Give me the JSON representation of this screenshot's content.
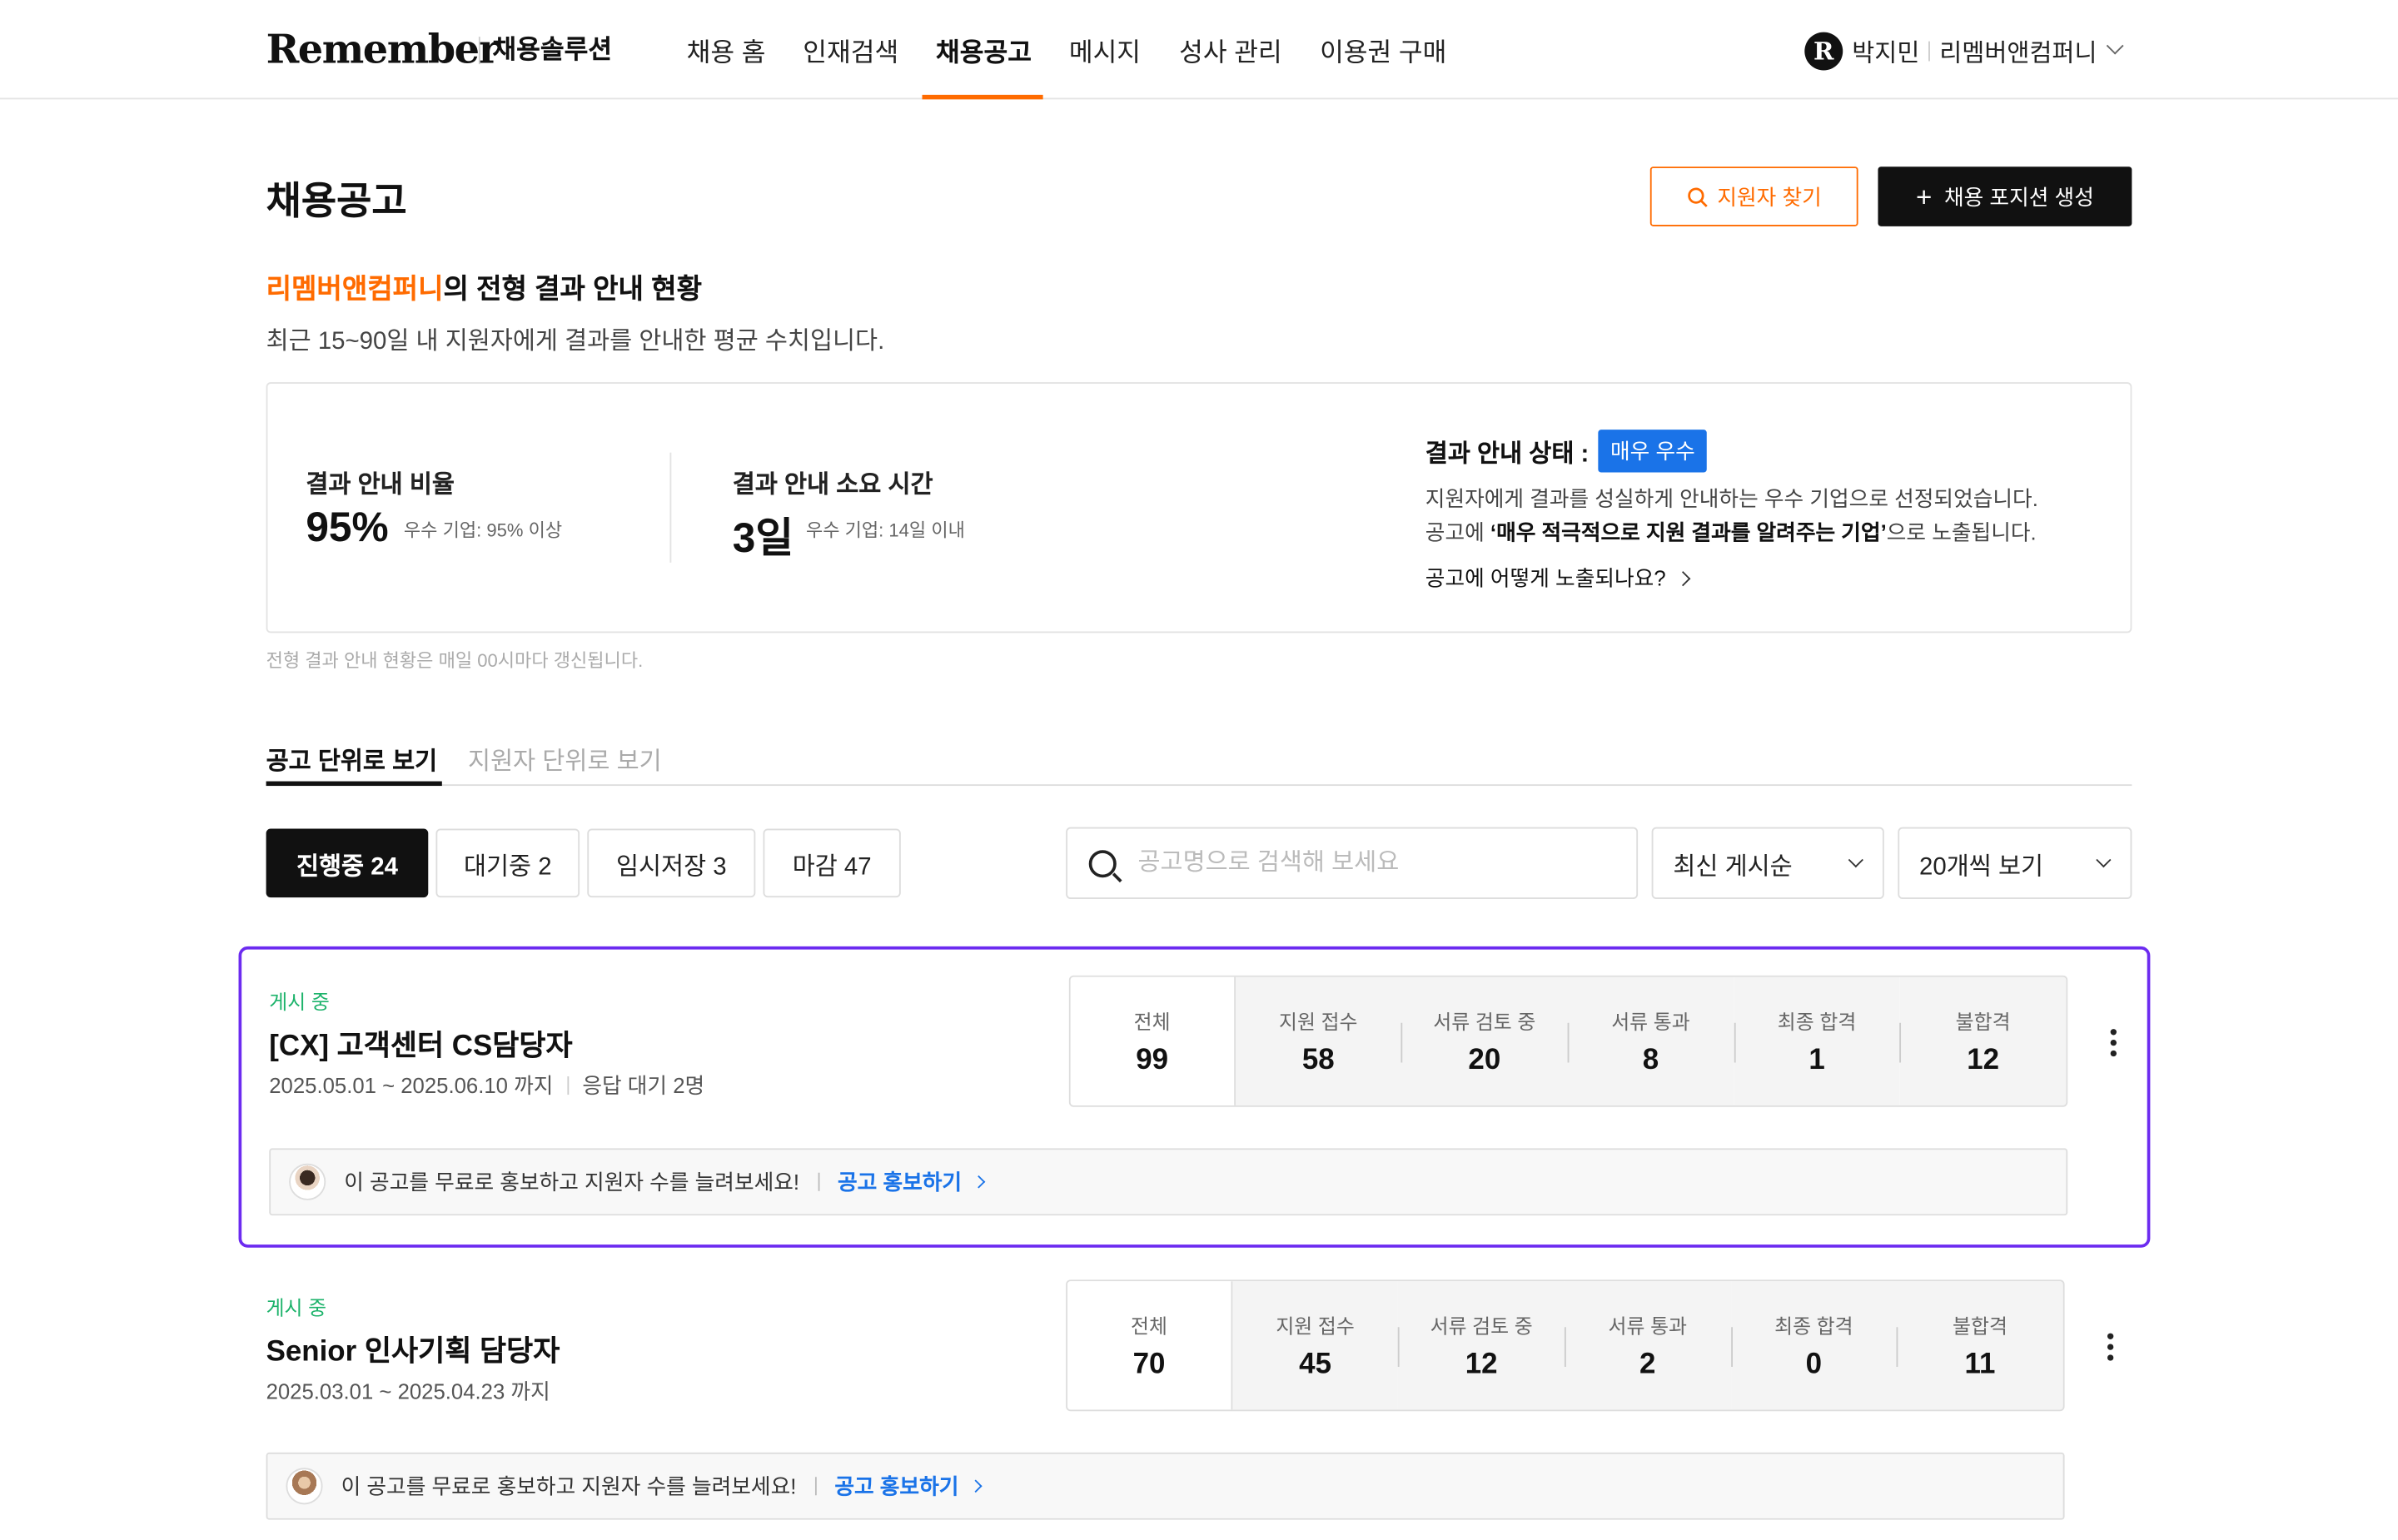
{
  "header": {
    "logo": "Remember",
    "logo_sub": "채용솔루션",
    "nav": [
      "채용 홈",
      "인재검색",
      "채용공고",
      "메시지",
      "성사 관리",
      "이용권 구매"
    ],
    "active_nav": "채용공고",
    "user_badge": "R",
    "user_name": "박지민",
    "company": "리멤버앤컴퍼니"
  },
  "page": {
    "title": "채용공고",
    "find_applicant_button": "지원자 찾기",
    "create_position_button": "채용 포지션 생성",
    "accent": "#ff6b00"
  },
  "summary": {
    "company": "리멤버앤컴퍼니",
    "heading_suffix": "의 전형 결과 안내 현황",
    "description": "최근 15~90일 내 지원자에게 결과를 안내한 평균 수치입니다.",
    "ratio_label": "결과 안내 비율",
    "ratio_value": "95%",
    "ratio_note": "우수 기업: 95% 이상",
    "time_label": "결과 안내 소요 시간",
    "time_value": "3일",
    "time_note": "우수 기업: 14일 이내",
    "status_label": "결과 안내 상태 :",
    "status_badge": "매우 우수",
    "status_desc_1": "지원자에게 결과를 성실하게 안내하는 우수 기업으로 선정되었습니다.",
    "status_desc_2_prefix": "공고에 ",
    "status_desc_2_bold": "‘매우 적극적으로 지원 결과를 알려주는 기업’",
    "status_desc_2_suffix": "으로 노출됩니다.",
    "status_link": "공고에 어떻게 노출되나요?",
    "update_note": "전형 결과 안내 현황은 매일 00시마다 갱신됩니다."
  },
  "view_tabs": [
    "공고 단위로 보기",
    "지원자 단위로 보기"
  ],
  "filters": {
    "chips": [
      "진행중 24",
      "대기중 2",
      "임시저장 3",
      "마감 47"
    ],
    "search_placeholder": "공고명으로 검색해 보세요",
    "sort": "최신 게시순",
    "page_size": "20개씩 보기"
  },
  "count_labels": [
    "전체",
    "지원 접수",
    "서류 검토 중",
    "서류 통과",
    "최종 합격",
    "불합격"
  ],
  "jobs": [
    {
      "status": "게시 중",
      "title": "[CX] 고객센터 CS담당자",
      "period": "2025.05.01 ~ 2025.06.10 까지",
      "pending": "응답 대기 2명",
      "counts": [
        "99",
        "58",
        "20",
        "8",
        "1",
        "12"
      ],
      "promo_text": "이 공고를 무료로 홍보하고 지원자 수를 늘려보세요!",
      "promo_link": "공고 홍보하기"
    },
    {
      "status": "게시 중",
      "title": "Senior 인사기획 담당자",
      "period": "2025.03.01 ~ 2025.04.23 까지",
      "counts": [
        "70",
        "45",
        "12",
        "2",
        "0",
        "11"
      ],
      "promo_text": "이 공고를 무료로 홍보하고 지원자 수를 늘려보세요!",
      "promo_link": "공고 홍보하기"
    }
  ]
}
